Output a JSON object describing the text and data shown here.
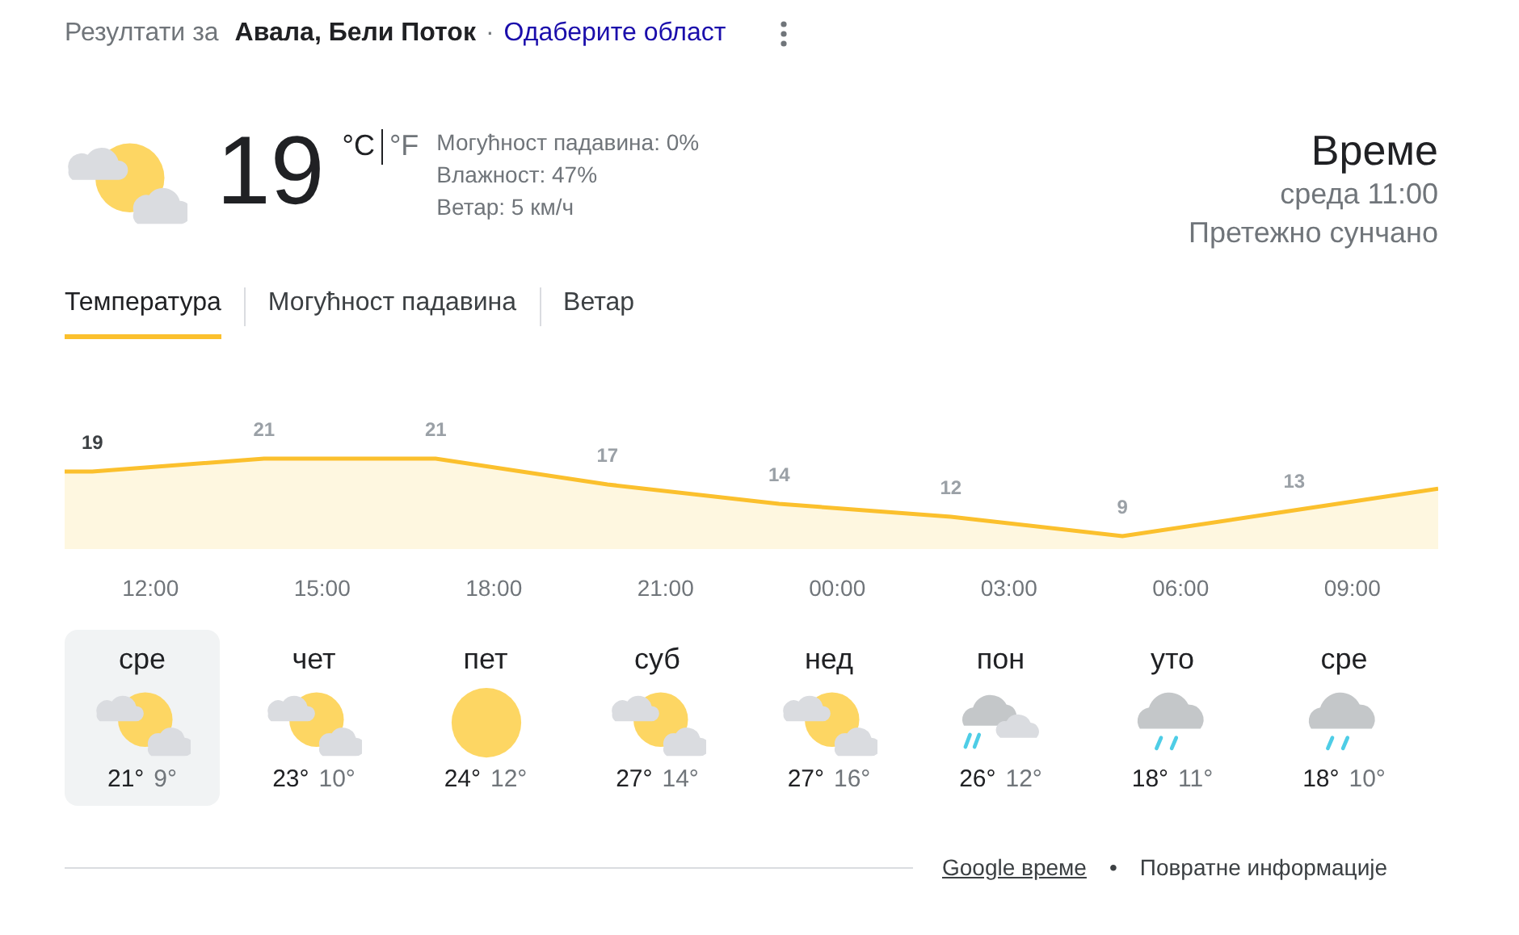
{
  "header": {
    "prefix": "Резултати за",
    "location": "Авала, Бели Поток",
    "separator": "·",
    "link": "Одаберите област"
  },
  "current": {
    "temperature": "19",
    "units": [
      {
        "label": "°C",
        "selected": true
      },
      {
        "label": "°F",
        "selected": false
      }
    ],
    "details": [
      "Могућност падавина: 0%",
      "Влажност: 47%",
      "Ветар: 5 км/ч"
    ]
  },
  "summary": {
    "title": "Време",
    "time": "среда 11:00",
    "condition": "Претежно сунчано"
  },
  "tabs": [
    {
      "label": "Температура",
      "selected": true
    },
    {
      "label": "Могућност падавина",
      "selected": false
    },
    {
      "label": "Ветар",
      "selected": false
    }
  ],
  "hourly": {
    "temperatures": [
      "19",
      "21",
      "21",
      "17",
      "14",
      "12",
      "9",
      "13"
    ],
    "times": [
      "12:00",
      "15:00",
      "18:00",
      "21:00",
      "00:00",
      "03:00",
      "06:00",
      "09:00"
    ]
  },
  "days": [
    {
      "day": "сре",
      "kind": "partly",
      "high": "21°",
      "low": "9°",
      "selected": true
    },
    {
      "day": "чет",
      "kind": "partly",
      "high": "23°",
      "low": "10°",
      "selected": false
    },
    {
      "day": "пет",
      "kind": "sunny",
      "high": "24°",
      "low": "12°",
      "selected": false
    },
    {
      "day": "суб",
      "kind": "partly",
      "high": "27°",
      "low": "14°",
      "selected": false
    },
    {
      "day": "нед",
      "kind": "partly",
      "high": "27°",
      "low": "16°",
      "selected": false
    },
    {
      "day": "пон",
      "kind": "showers",
      "high": "26°",
      "low": "12°",
      "selected": false
    },
    {
      "day": "уто",
      "kind": "rain",
      "high": "18°",
      "low": "11°",
      "selected": false
    },
    {
      "day": "сре",
      "kind": "rain",
      "high": "18°",
      "low": "10°",
      "selected": false
    }
  ],
  "footer": {
    "link": "Google време",
    "separator": "•",
    "feedback": "Повратне информације"
  }
}
